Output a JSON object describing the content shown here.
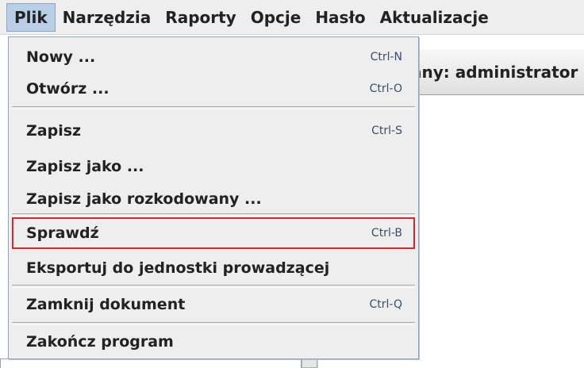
{
  "menubar": {
    "items": [
      {
        "label": "Plik"
      },
      {
        "label": "Narzędzia"
      },
      {
        "label": "Raporty"
      },
      {
        "label": "Opcje"
      },
      {
        "label": "Hasło"
      },
      {
        "label": "Aktualizacje"
      }
    ]
  },
  "background": {
    "header_text": "any: administrator"
  },
  "file_menu": {
    "items": [
      {
        "label": "Nowy ...",
        "shortcut": "Ctrl-N"
      },
      {
        "label": "Otwórz ...",
        "shortcut": "Ctrl-O"
      },
      {
        "label": "Zapisz",
        "shortcut": "Ctrl-S"
      },
      {
        "label": "Zapisz jako ...",
        "shortcut": ""
      },
      {
        "label": "Zapisz jako rozkodowany ...",
        "shortcut": ""
      },
      {
        "label": "Sprawdź",
        "shortcut": "Ctrl-B"
      },
      {
        "label": "Eksportuj do jednostki prowadzącej",
        "shortcut": ""
      },
      {
        "label": "Zamknij dokument",
        "shortcut": "Ctrl-Q"
      },
      {
        "label": "Zakończ program",
        "shortcut": ""
      }
    ],
    "highlight_color": "#e0242e",
    "active_menu_color": "#b8cfe5"
  }
}
